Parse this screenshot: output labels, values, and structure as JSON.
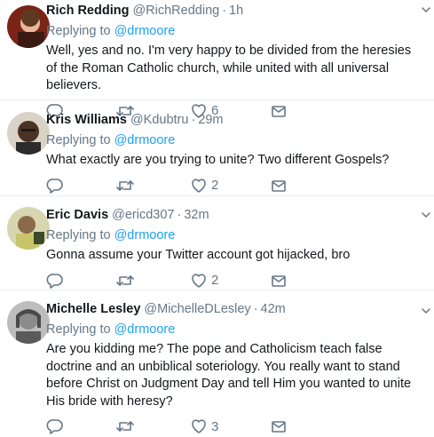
{
  "tweets": [
    {
      "name": "Rich Redding",
      "handle": "@RichRedding",
      "separator": "·",
      "time": "1h",
      "replying_prefix": "Replying to ",
      "replying_to": "@drmoore",
      "text": "Well, yes and no. I'm very happy to be divided from the heresies of the Roman Catholic church, while united with all universal believers.",
      "likes": "6",
      "avatar_color": "#8b2e1f"
    },
    {
      "name": "Kris Williams",
      "handle": "@Kdubtru",
      "separator": "·",
      "time": "29m",
      "replying_prefix": "Replying to ",
      "replying_to": "@drmoore",
      "text": "What exactly are you trying to unite? Two different Gospels?",
      "likes": "2",
      "avatar_color": "#4a3324"
    },
    {
      "name": "Eric Davis",
      "handle": "@ericd307",
      "separator": "·",
      "time": "32m",
      "replying_prefix": "Replying to ",
      "replying_to": "@drmoore",
      "text": "Gonna assume your Twitter account got hijacked, bro",
      "likes": "2",
      "avatar_color": "#c9c46a"
    },
    {
      "name": "Michelle Lesley",
      "handle": "@MichelleDLesley",
      "separator": "·",
      "time": "42m",
      "replying_prefix": "Replying to ",
      "replying_to": "@drmoore",
      "text": "Are you kidding me? The pope and Catholicism teach false doctrine and an unbiblical soteriology. You really want to stand before Christ on Judgment Day and tell Him you wanted to unite His bride with heresy?",
      "likes": "3",
      "avatar_color": "#6e6e6e"
    }
  ],
  "icons": {
    "reply": "reply-icon",
    "retweet": "retweet-icon",
    "like": "heart-icon",
    "message": "envelope-icon",
    "menu": "chevron-down-icon"
  },
  "colors": {
    "accent": "#1da1f2",
    "muted": "#657786",
    "text": "#14171a",
    "divider": "#e6ecf0"
  }
}
